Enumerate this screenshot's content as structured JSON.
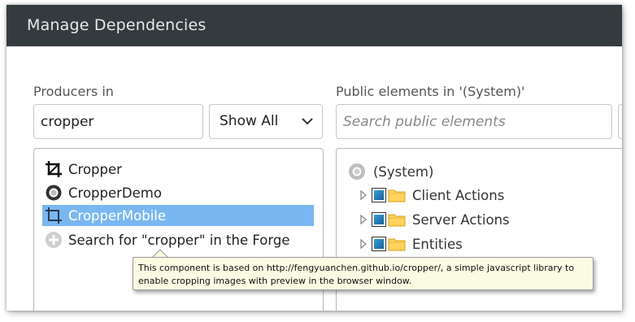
{
  "dialog": {
    "title": "Manage Dependencies"
  },
  "producers": {
    "label": "Producers in",
    "search_value": "cropper",
    "filter_value": "Show All",
    "items": [
      {
        "label": "Cropper",
        "icon": "crop-icon"
      },
      {
        "label": "CropperDemo",
        "icon": "app-circle-icon"
      },
      {
        "label": "CropperMobile",
        "icon": "crop-icon",
        "selected": true
      },
      {
        "label": "Search for \"cropper\" in the Forge",
        "icon": "plus-circle-icon"
      }
    ]
  },
  "public_elements": {
    "label": "Public elements in '(System)'",
    "search_placeholder": "Search public elements",
    "root": {
      "label": "(System)",
      "icon": "system-circle-icon"
    },
    "children": [
      {
        "label": "Client Actions"
      },
      {
        "label": "Server Actions"
      },
      {
        "label": "Entities"
      }
    ]
  },
  "tooltip": {
    "text": "This component is based on http://fengyuanchen.github.io/cropper/, a simple javascript library to enable cropping images with preview in the browser window."
  },
  "colors": {
    "titlebar": "#343b3e",
    "selection": "#7ab7f0",
    "tooltip_bg": "#fbfbe3"
  }
}
